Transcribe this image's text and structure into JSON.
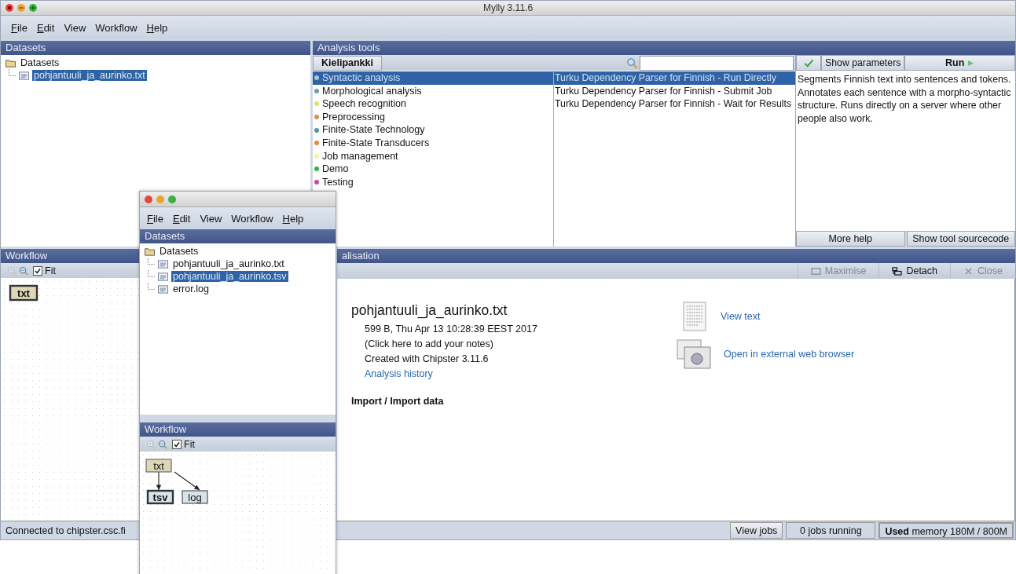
{
  "window": {
    "title": "Mylly 3.11.6"
  },
  "menu": [
    {
      "label": "File",
      "mnemonic": true
    },
    {
      "label": "Edit",
      "mnemonic": true
    },
    {
      "label": "View",
      "mnemonic": false
    },
    {
      "label": "Workflow",
      "mnemonic": false
    },
    {
      "label": "Help",
      "mnemonic": true
    }
  ],
  "datasets": {
    "title": "Datasets",
    "root": "Datasets",
    "children": [
      {
        "name": "pohjantuuli_ja_aurinko.txt",
        "selected": true
      }
    ]
  },
  "analysis_tools": {
    "title": "Analysis tools",
    "module_button": "Kielipankki",
    "tool_ready": true,
    "show_parameters": "Show parameters",
    "run_button": "Run",
    "categories": [
      {
        "name": "Syntactic analysis",
        "color": "#a9c6de",
        "selected": true
      },
      {
        "name": "Morphological analysis",
        "color": "#6f9fb3",
        "selected": false
      },
      {
        "name": "Speech recognition",
        "color": "#dde36f",
        "selected": false
      },
      {
        "name": "Preprocessing",
        "color": "#c99b52",
        "selected": false
      },
      {
        "name": "Finite-State Technology",
        "color": "#4b9a9b",
        "selected": false
      },
      {
        "name": "Finite-State Transducers",
        "color": "#e88b32",
        "selected": false
      },
      {
        "name": "Job management",
        "color": "#f2f1a4",
        "selected": false
      },
      {
        "name": "Demo",
        "color": "#3fae43",
        "selected": false
      },
      {
        "name": "Testing",
        "color": "#c04f9d",
        "selected": false
      }
    ],
    "tools": [
      {
        "name": "Turku Dependency Parser for Finnish - Run Directly",
        "selected": true
      },
      {
        "name": "Turku Dependency Parser for Finnish - Submit Job",
        "selected": false
      },
      {
        "name": "Turku Dependency Parser for Finnish - Wait for Results",
        "selected": false
      }
    ],
    "description": "Segments Finnish text into sentences and tokens. Annotates each sentence with a morpho-syntactic structure. Runs directly on a server where other people also work.",
    "more_help": "More help",
    "show_sourcecode": "Show tool sourcecode"
  },
  "workflow": {
    "title": "Workflow",
    "fit": {
      "label": "Fit",
      "checked": true
    },
    "nodes": [
      {
        "label": "txt",
        "selected": true
      }
    ]
  },
  "visualisation": {
    "title": "alisation",
    "actions": [
      {
        "label": "Maximise",
        "kind": "maximise",
        "disabled": true
      },
      {
        "label": "Detach",
        "kind": "detach",
        "disabled": false
      },
      {
        "label": "Close",
        "kind": "close",
        "disabled": true
      }
    ],
    "file_name": "pohjantuuli_ja_aurinko.txt",
    "details": [
      "599 B, Thu Apr 13 10:28:39 EEST 2017",
      "(Click here to add your notes)",
      "Created with Chipster 3.11.6"
    ],
    "history_link": "Analysis history",
    "operation": "Import / Import data",
    "links": [
      {
        "label": "View text",
        "kind": "text"
      },
      {
        "label": "Open in external web browser",
        "kind": "browser"
      }
    ]
  },
  "status_bar": {
    "connection": "Connected to chipster.csc.fi",
    "view_jobs": "View jobs",
    "jobs": "0 jobs running",
    "memory": "**Used** memory 180M / 800M"
  },
  "second_window": {
    "menu": [
      {
        "label": "File",
        "mnemonic": true
      },
      {
        "label": "Edit",
        "mnemonic": true
      },
      {
        "label": "View",
        "mnemonic": false
      },
      {
        "label": "Workflow",
        "mnemonic": false
      },
      {
        "label": "Help",
        "mnemonic": true
      }
    ],
    "datasets": {
      "title": "Datasets",
      "root": "Datasets",
      "children": [
        {
          "name": "pohjantuuli_ja_aurinko.txt",
          "selected": false
        },
        {
          "name": "pohjantuuli_ja_aurinko.tsv",
          "selected": true
        },
        {
          "name": "error.log",
          "selected": false
        }
      ]
    },
    "workflow": {
      "title": "Workflow",
      "fit": {
        "label": "Fit",
        "checked": true
      },
      "nodes": [
        {
          "label": "txt",
          "selected": false,
          "children": [
            {
              "label": "tsv",
              "selected": true
            },
            {
              "label": "log",
              "selected": false
            }
          ]
        }
      ]
    }
  }
}
